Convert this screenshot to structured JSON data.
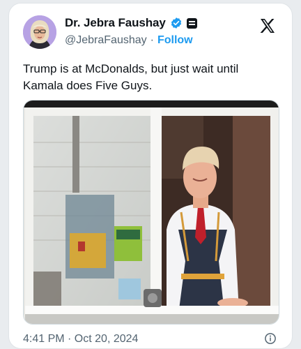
{
  "author": {
    "display_name": "Dr. Jebra Faushay",
    "handle": "@JebraFaushay",
    "separator": "·",
    "follow_label": "Follow",
    "verified_color": "#1d9bf0",
    "avatar_icon": "profile-photo"
  },
  "post": {
    "text": "Trump is at McDonalds, but just wait until Kamala does Five Guys.",
    "timestamp": "4:41 PM · Oct 20, 2024"
  },
  "media": {
    "type": "video-frame",
    "description_icon": "drive-thru-window-photo"
  },
  "colors": {
    "text_primary": "#0f1419",
    "text_secondary": "#536471",
    "accent": "#1d9bf0"
  }
}
